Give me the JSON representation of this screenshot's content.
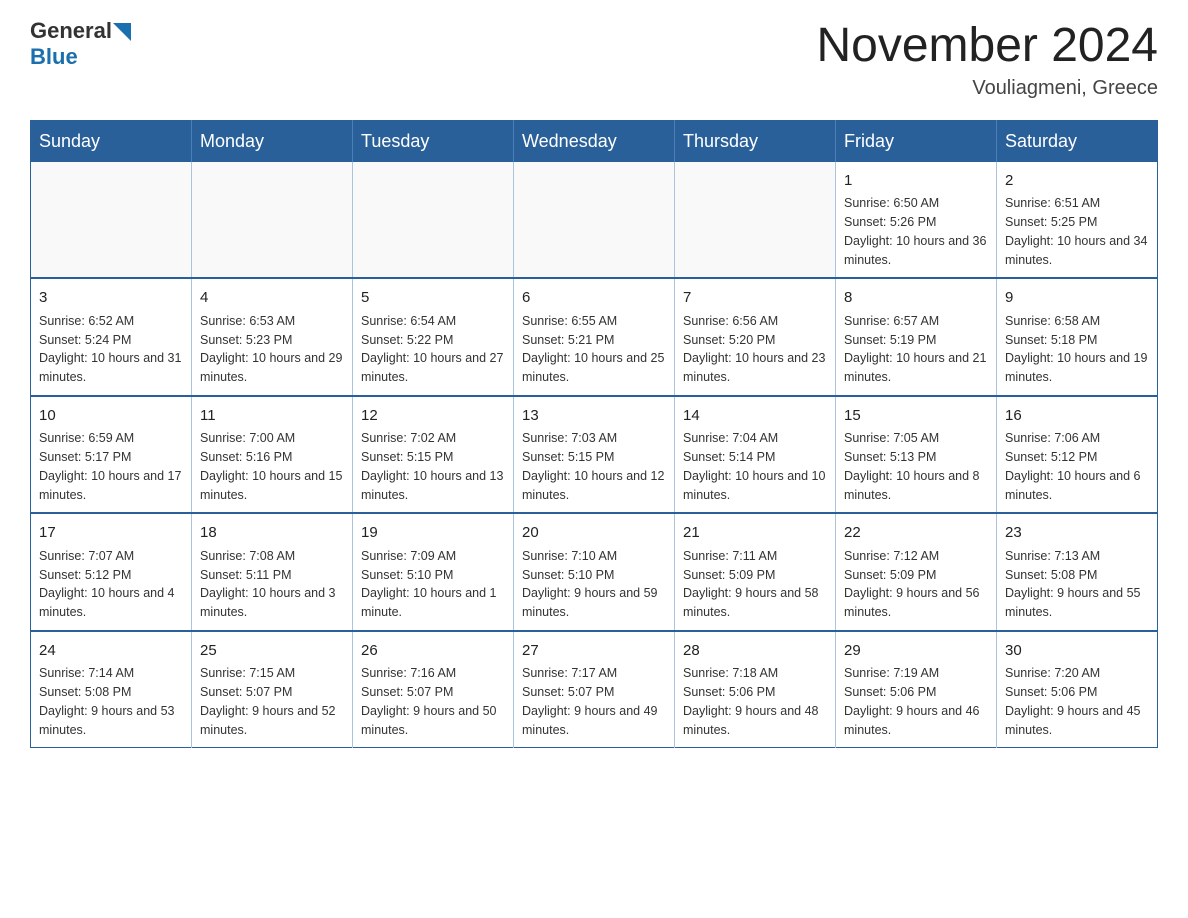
{
  "header": {
    "logo_general": "General",
    "logo_blue": "Blue",
    "month_title": "November 2024",
    "location": "Vouliagmeni, Greece"
  },
  "days_of_week": [
    "Sunday",
    "Monday",
    "Tuesday",
    "Wednesday",
    "Thursday",
    "Friday",
    "Saturday"
  ],
  "weeks": [
    [
      {
        "day": "",
        "content": ""
      },
      {
        "day": "",
        "content": ""
      },
      {
        "day": "",
        "content": ""
      },
      {
        "day": "",
        "content": ""
      },
      {
        "day": "",
        "content": ""
      },
      {
        "day": "1",
        "content": "Sunrise: 6:50 AM\nSunset: 5:26 PM\nDaylight: 10 hours and 36 minutes."
      },
      {
        "day": "2",
        "content": "Sunrise: 6:51 AM\nSunset: 5:25 PM\nDaylight: 10 hours and 34 minutes."
      }
    ],
    [
      {
        "day": "3",
        "content": "Sunrise: 6:52 AM\nSunset: 5:24 PM\nDaylight: 10 hours and 31 minutes."
      },
      {
        "day": "4",
        "content": "Sunrise: 6:53 AM\nSunset: 5:23 PM\nDaylight: 10 hours and 29 minutes."
      },
      {
        "day": "5",
        "content": "Sunrise: 6:54 AM\nSunset: 5:22 PM\nDaylight: 10 hours and 27 minutes."
      },
      {
        "day": "6",
        "content": "Sunrise: 6:55 AM\nSunset: 5:21 PM\nDaylight: 10 hours and 25 minutes."
      },
      {
        "day": "7",
        "content": "Sunrise: 6:56 AM\nSunset: 5:20 PM\nDaylight: 10 hours and 23 minutes."
      },
      {
        "day": "8",
        "content": "Sunrise: 6:57 AM\nSunset: 5:19 PM\nDaylight: 10 hours and 21 minutes."
      },
      {
        "day": "9",
        "content": "Sunrise: 6:58 AM\nSunset: 5:18 PM\nDaylight: 10 hours and 19 minutes."
      }
    ],
    [
      {
        "day": "10",
        "content": "Sunrise: 6:59 AM\nSunset: 5:17 PM\nDaylight: 10 hours and 17 minutes."
      },
      {
        "day": "11",
        "content": "Sunrise: 7:00 AM\nSunset: 5:16 PM\nDaylight: 10 hours and 15 minutes."
      },
      {
        "day": "12",
        "content": "Sunrise: 7:02 AM\nSunset: 5:15 PM\nDaylight: 10 hours and 13 minutes."
      },
      {
        "day": "13",
        "content": "Sunrise: 7:03 AM\nSunset: 5:15 PM\nDaylight: 10 hours and 12 minutes."
      },
      {
        "day": "14",
        "content": "Sunrise: 7:04 AM\nSunset: 5:14 PM\nDaylight: 10 hours and 10 minutes."
      },
      {
        "day": "15",
        "content": "Sunrise: 7:05 AM\nSunset: 5:13 PM\nDaylight: 10 hours and 8 minutes."
      },
      {
        "day": "16",
        "content": "Sunrise: 7:06 AM\nSunset: 5:12 PM\nDaylight: 10 hours and 6 minutes."
      }
    ],
    [
      {
        "day": "17",
        "content": "Sunrise: 7:07 AM\nSunset: 5:12 PM\nDaylight: 10 hours and 4 minutes."
      },
      {
        "day": "18",
        "content": "Sunrise: 7:08 AM\nSunset: 5:11 PM\nDaylight: 10 hours and 3 minutes."
      },
      {
        "day": "19",
        "content": "Sunrise: 7:09 AM\nSunset: 5:10 PM\nDaylight: 10 hours and 1 minute."
      },
      {
        "day": "20",
        "content": "Sunrise: 7:10 AM\nSunset: 5:10 PM\nDaylight: 9 hours and 59 minutes."
      },
      {
        "day": "21",
        "content": "Sunrise: 7:11 AM\nSunset: 5:09 PM\nDaylight: 9 hours and 58 minutes."
      },
      {
        "day": "22",
        "content": "Sunrise: 7:12 AM\nSunset: 5:09 PM\nDaylight: 9 hours and 56 minutes."
      },
      {
        "day": "23",
        "content": "Sunrise: 7:13 AM\nSunset: 5:08 PM\nDaylight: 9 hours and 55 minutes."
      }
    ],
    [
      {
        "day": "24",
        "content": "Sunrise: 7:14 AM\nSunset: 5:08 PM\nDaylight: 9 hours and 53 minutes."
      },
      {
        "day": "25",
        "content": "Sunrise: 7:15 AM\nSunset: 5:07 PM\nDaylight: 9 hours and 52 minutes."
      },
      {
        "day": "26",
        "content": "Sunrise: 7:16 AM\nSunset: 5:07 PM\nDaylight: 9 hours and 50 minutes."
      },
      {
        "day": "27",
        "content": "Sunrise: 7:17 AM\nSunset: 5:07 PM\nDaylight: 9 hours and 49 minutes."
      },
      {
        "day": "28",
        "content": "Sunrise: 7:18 AM\nSunset: 5:06 PM\nDaylight: 9 hours and 48 minutes."
      },
      {
        "day": "29",
        "content": "Sunrise: 7:19 AM\nSunset: 5:06 PM\nDaylight: 9 hours and 46 minutes."
      },
      {
        "day": "30",
        "content": "Sunrise: 7:20 AM\nSunset: 5:06 PM\nDaylight: 9 hours and 45 minutes."
      }
    ]
  ]
}
